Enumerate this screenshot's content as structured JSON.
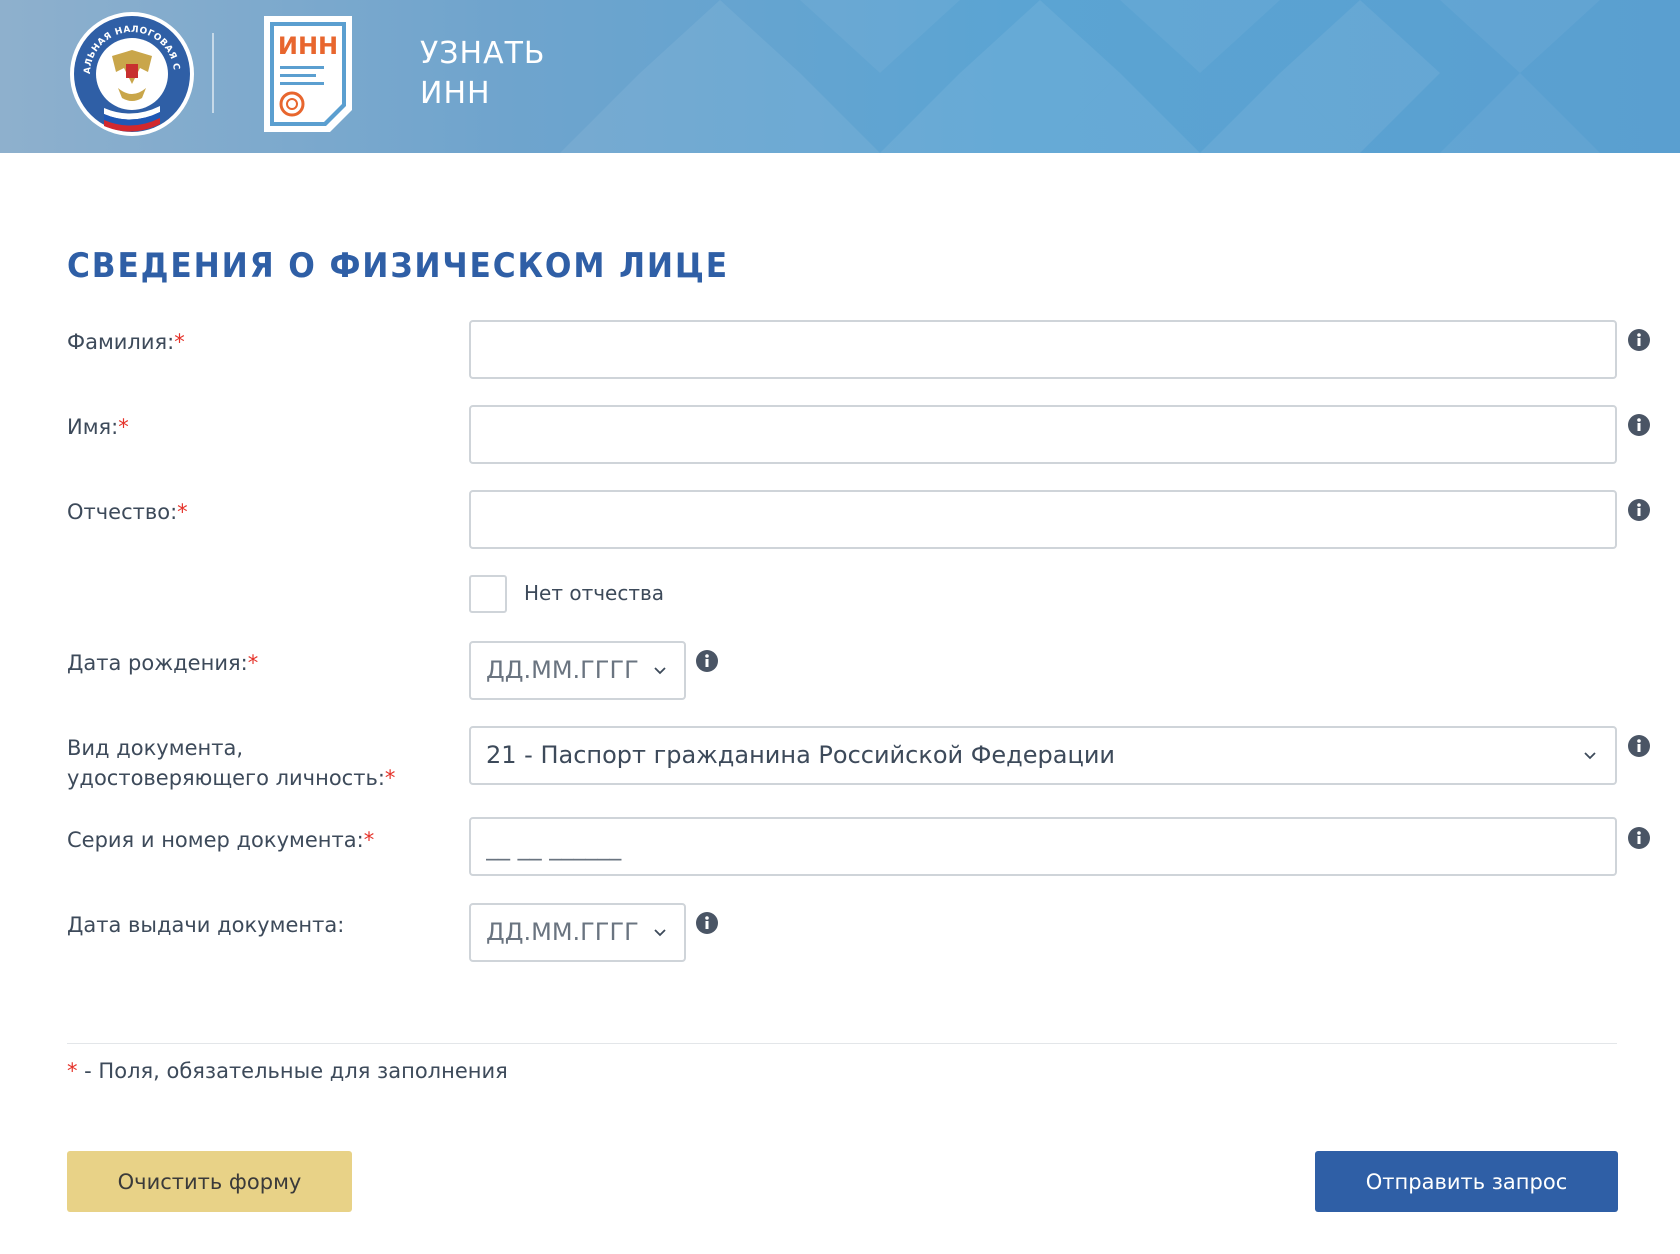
{
  "header": {
    "title_line1": "УЗНАТЬ",
    "title_line2": "ИНН",
    "inn_logo_text": "ИНН",
    "fns_emblem_text": "ФЕДЕРАЛЬНАЯ НАЛОГОВАЯ СЛУЖБА"
  },
  "form": {
    "section_title": "СВЕДЕНИЯ О ФИЗИЧЕСКОМ ЛИЦЕ",
    "required_mark": "*",
    "surname": {
      "label": "Фамилия:",
      "value": "",
      "placeholder": ""
    },
    "first_name": {
      "label": "Имя:",
      "value": "",
      "placeholder": ""
    },
    "patronymic": {
      "label": "Отчество:",
      "value": "",
      "placeholder": ""
    },
    "no_patronymic": {
      "label": "Нет отчества",
      "checked": false
    },
    "birth_date": {
      "label": "Дата рождения:",
      "placeholder": "ДД.ММ.ГГГГ"
    },
    "doc_type": {
      "label_line1": "Вид документа,",
      "label_line2": "удостоверяющего личность:",
      "selected": "21 - Паспорт гражданина Российской Федерации"
    },
    "doc_number": {
      "label": "Серия и номер документа:",
      "placeholder": "__ __ ______"
    },
    "issue_date": {
      "label": "Дата выдачи документа:",
      "placeholder": "ДД.ММ.ГГГГ"
    }
  },
  "footnote": {
    "mark": "*",
    "text": " - Поля, обязательные для заполнения"
  },
  "buttons": {
    "clear": "Очистить форму",
    "submit": "Отправить запрос"
  },
  "colors": {
    "brand_blue": "#2f5fa6",
    "required_red": "#e5332a",
    "clear_button": "#e8d287",
    "inn_orange": "#e8662e"
  }
}
